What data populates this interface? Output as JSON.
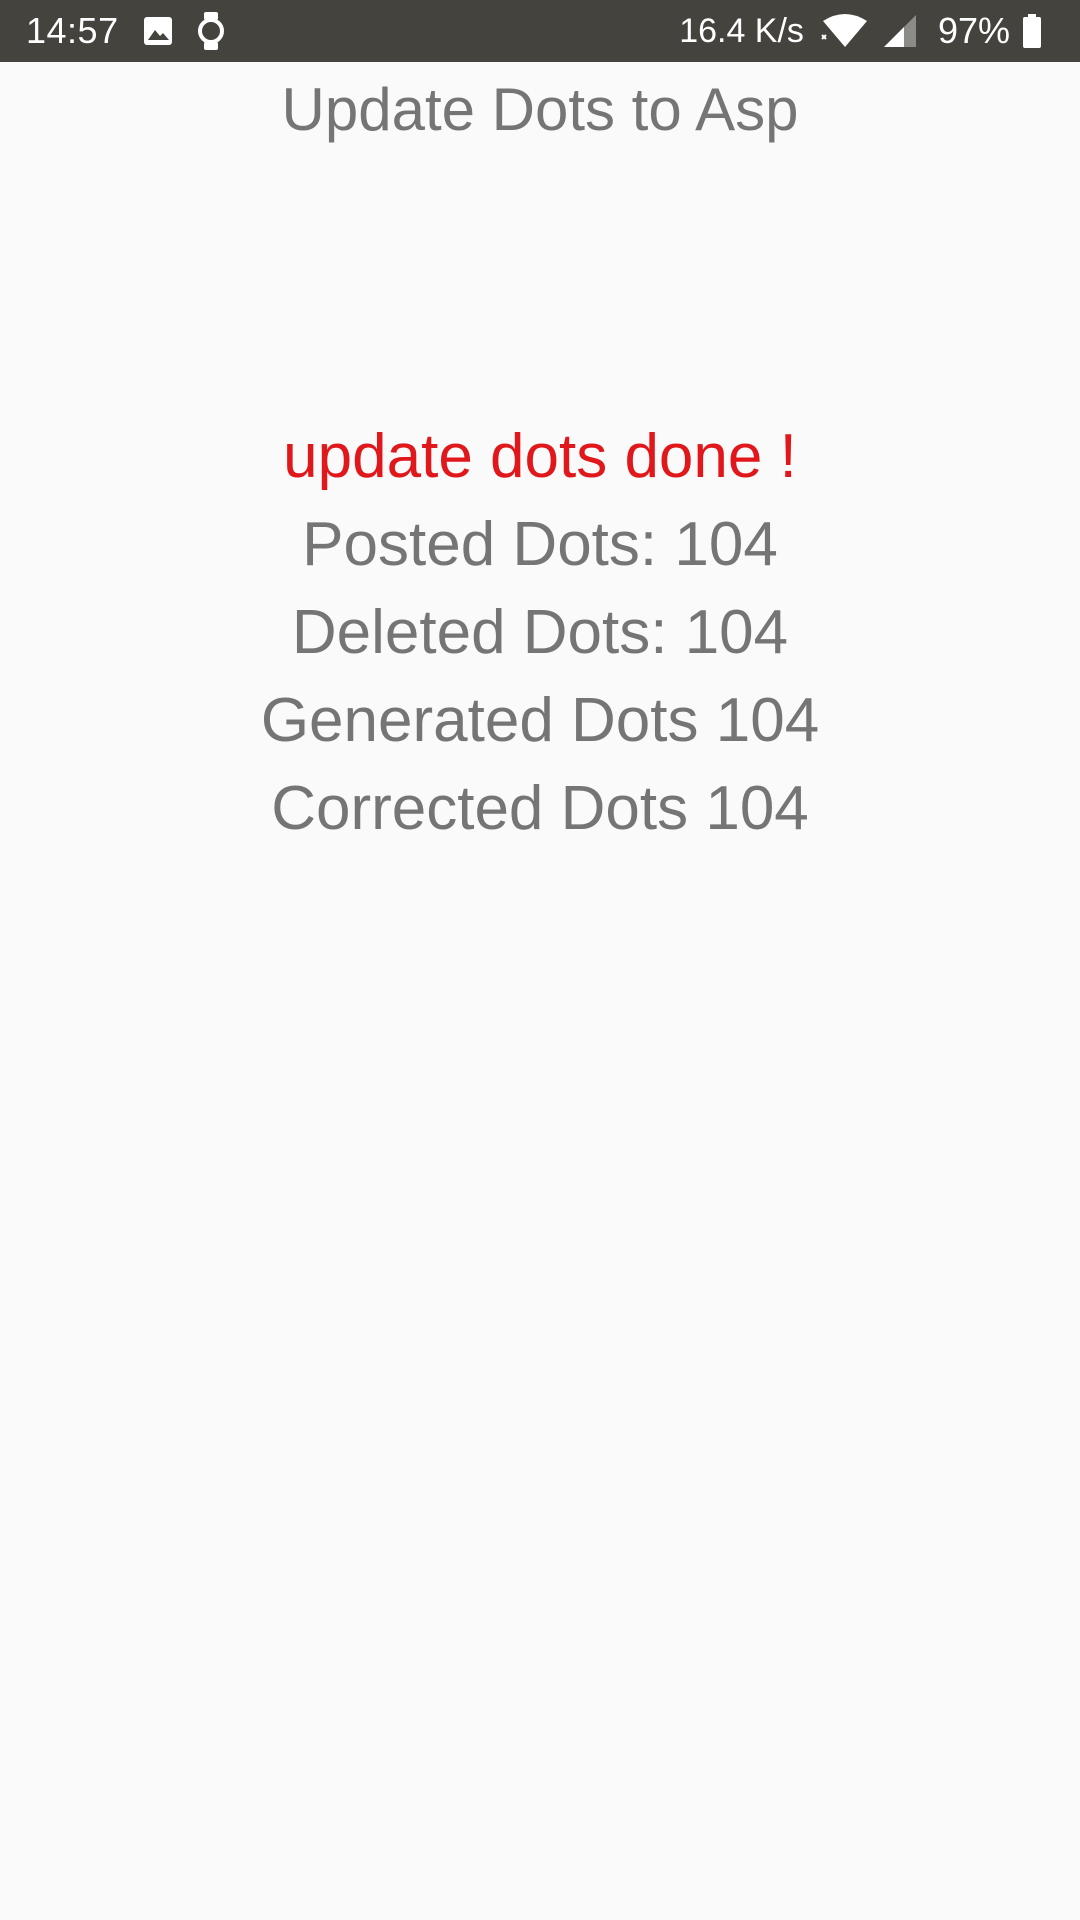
{
  "status_bar": {
    "time": "14:57",
    "net_speed": "16.4 K/s",
    "battery": "97%",
    "icons": [
      "image-notification-icon",
      "watch-icon",
      "wifi-icon",
      "cell-signal-icon",
      "battery-icon"
    ],
    "background": "#45433d"
  },
  "page": {
    "title": "Update Dots to Asp"
  },
  "result": {
    "status": "update dots done !",
    "status_color": "#e0181c",
    "posted": "Posted Dots: 104",
    "deleted": "Deleted Dots: 104",
    "generated": "Generated Dots 104",
    "corrected": "Corrected Dots 104"
  }
}
